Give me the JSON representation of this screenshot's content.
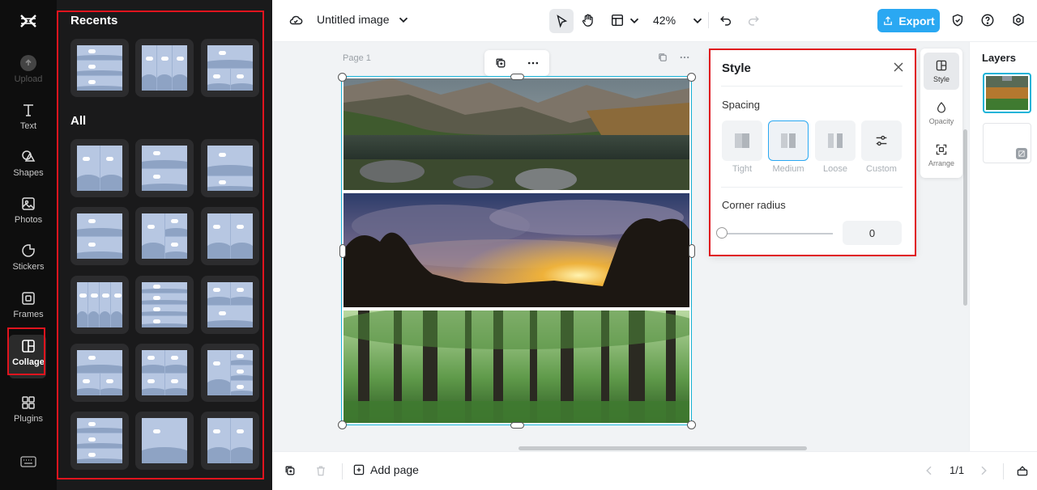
{
  "rail": {
    "logo": "capcut-logo-icon",
    "items": [
      {
        "label": "Upload",
        "icon": "upload-icon"
      },
      {
        "label": "Text",
        "icon": "text-icon"
      },
      {
        "label": "Shapes",
        "icon": "shapes-icon"
      },
      {
        "label": "Photos",
        "icon": "photos-icon"
      },
      {
        "label": "Stickers",
        "icon": "stickers-icon"
      },
      {
        "label": "Frames",
        "icon": "frames-icon"
      },
      {
        "label": "Collage",
        "icon": "collage-icon"
      },
      {
        "label": "Plugins",
        "icon": "plugins-icon"
      }
    ],
    "active": "Collage"
  },
  "panel": {
    "recents_title": "Recents",
    "all_title": "All",
    "recent_count": 3,
    "all_rows": 5
  },
  "topbar": {
    "doc_title": "Untitled image",
    "zoom": "42%",
    "export_label": "Export"
  },
  "canvas": {
    "page_label": "Page 1",
    "photos": [
      "mountain-lake-photo",
      "sunset-clouds-photo",
      "forest-photo"
    ]
  },
  "style_panel": {
    "title": "Style",
    "spacing_label": "Spacing",
    "spacing_options": [
      "Tight",
      "Medium",
      "Loose",
      "Custom"
    ],
    "spacing_selected": "Medium",
    "corner_radius_label": "Corner radius",
    "corner_radius_value": "0"
  },
  "tools": {
    "items": [
      "Style",
      "Opacity",
      "Arrange"
    ],
    "active": "Style"
  },
  "layers": {
    "title": "Layers"
  },
  "bottombar": {
    "add_page_label": "Add page",
    "page_count": "1/1"
  },
  "colors": {
    "accent": "#2aa8f2",
    "selection": "#18b3d8",
    "highlight": "#e0141e",
    "rail_bg": "#0e0e0e",
    "panel_bg": "#1a1a1b"
  }
}
